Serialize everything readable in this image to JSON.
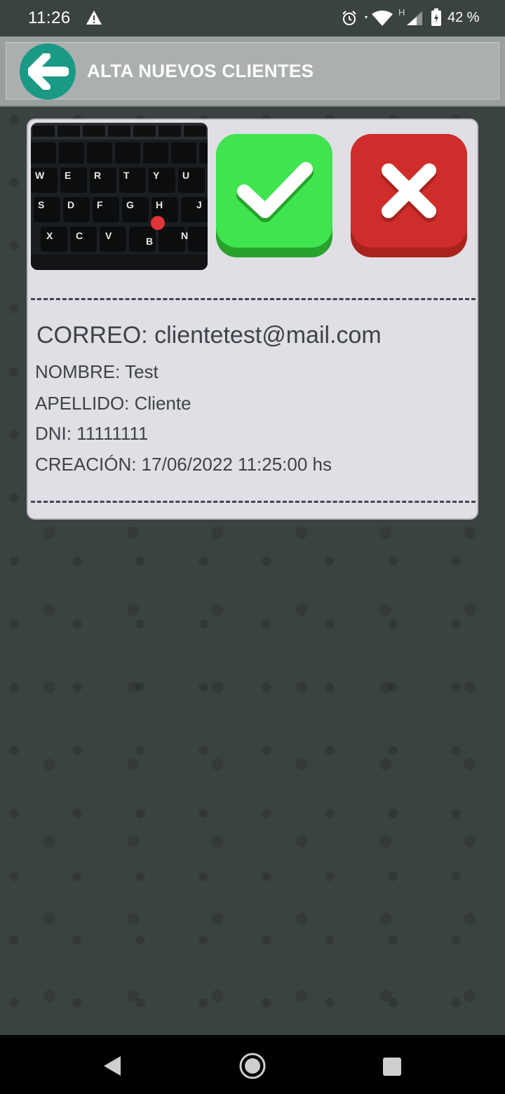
{
  "status_bar": {
    "time": "11:26",
    "network_label": "H",
    "battery": "42 %",
    "icons": [
      "warning-icon",
      "alarm-icon",
      "wifi-icon",
      "signal-icon",
      "battery-icon"
    ]
  },
  "header": {
    "title": "ALTA NUEVOS CLIENTES",
    "back_icon": "arrow-left-icon"
  },
  "card": {
    "photo_alt": "keyboard-photo",
    "accept_icon": "check-icon",
    "reject_icon": "cross-icon",
    "email_line": "CORREO: clientetest@mail.com",
    "name_line": "NOMBRE: Test",
    "surname_line": "APELLIDO: Cliente",
    "dni_line": "DNI: 11111111",
    "created_line": "CREACIÓN: 17/06/2022 11:25:00 hs"
  },
  "keyboard_photo": {
    "row1": [
      "W",
      "E",
      "R",
      "T",
      "Y",
      "U"
    ],
    "row2": [
      "S",
      "D",
      "F",
      "G",
      "H",
      "J"
    ],
    "row3": [
      "X",
      "C",
      "V",
      "B",
      "N"
    ]
  },
  "nav_bar": {
    "icons": [
      "nav-back-icon",
      "nav-home-icon",
      "nav-recents-icon"
    ]
  },
  "colors": {
    "accent": "#1a9a86",
    "accept": "#3fe44f",
    "reject": "#cf2d2b",
    "background": "#3b4342"
  }
}
